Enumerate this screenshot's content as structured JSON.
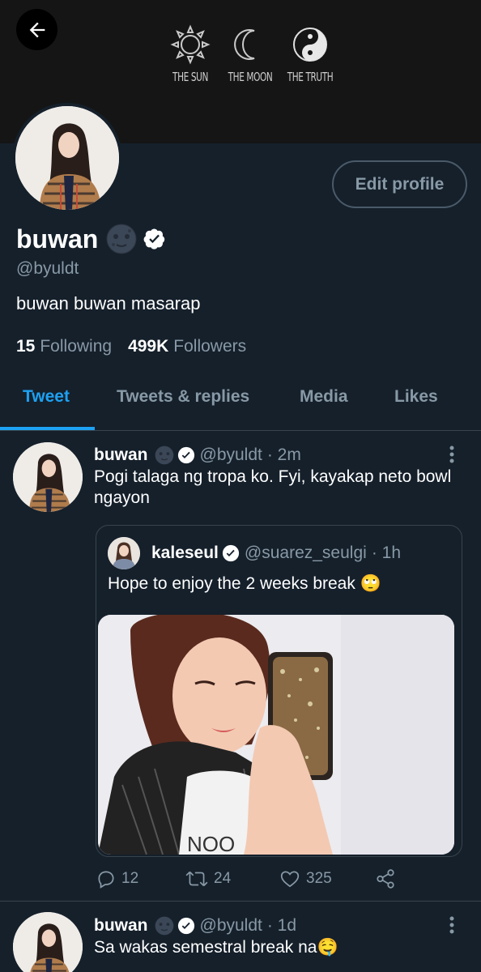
{
  "banner": {
    "items": [
      {
        "icon": "sun-icon",
        "caption": "THE SUN"
      },
      {
        "icon": "moon-icon",
        "caption": "THE MOON"
      },
      {
        "icon": "yin-yang-icon",
        "caption": "THE TRUTH"
      }
    ]
  },
  "profile": {
    "name": "buwan",
    "emoji": "new-moon-face-emoji",
    "handle": "@byuldt",
    "bio": "buwan buwan masarap",
    "following_count": "15",
    "following_label": "Following",
    "followers_count": "499K",
    "followers_label": "Followers",
    "edit_label": "Edit profile"
  },
  "tabs": [
    {
      "label": "Tweet",
      "active": true
    },
    {
      "label": "Tweets & replies",
      "active": false
    },
    {
      "label": "Media",
      "active": false
    },
    {
      "label": "Likes",
      "active": false
    }
  ],
  "tweets": [
    {
      "name": "buwan",
      "handle": "@byuldt",
      "time": "· 2m",
      "text": "Pogi talaga ng tropa ko. Fyi, kayakap neto bowl ngayon",
      "quote": {
        "name": "kaleseul",
        "handle": "@suarez_seulgi",
        "time": "· 1h",
        "text": "Hope to enjoy the 2 weeks break 🙄"
      },
      "replies": "12",
      "retweets": "24",
      "likes": "325"
    },
    {
      "name": "buwan",
      "handle": "@byuldt",
      "time": "· 1d",
      "text": "Sa wakas semestral break na🤤"
    }
  ],
  "colors": {
    "background": "#15202b",
    "accent": "#1da1f2",
    "muted": "#8899a6",
    "border": "#38444d"
  }
}
